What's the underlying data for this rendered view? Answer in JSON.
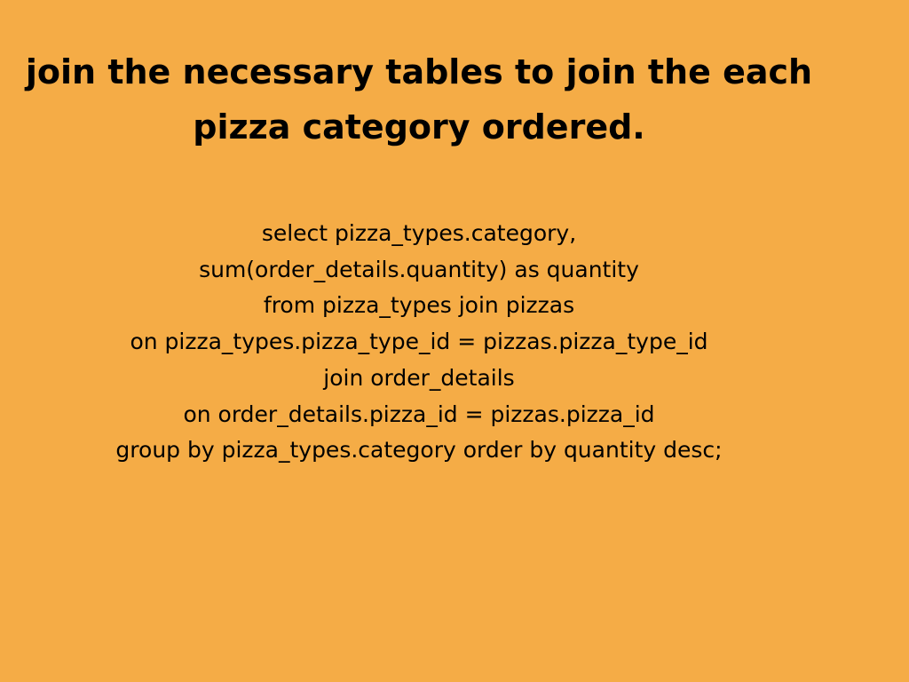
{
  "colors": {
    "background": "#F5AC46",
    "text": "#000000"
  },
  "title": {
    "lines": [
      "join the necessary tables to join the each",
      "pizza category ordered."
    ]
  },
  "code": {
    "lines": [
      "select pizza_types.category,",
      "sum(order_details.quantity) as quantity",
      "from pizza_types join pizzas",
      "on pizza_types.pizza_type_id = pizzas.pizza_type_id",
      "join order_details",
      "on order_details.pizza_id = pizzas.pizza_id",
      "group by pizza_types.category order by quantity desc;"
    ]
  }
}
